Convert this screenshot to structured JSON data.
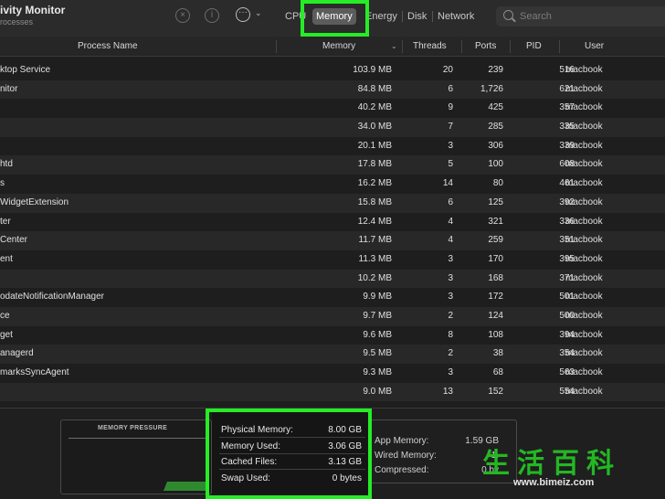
{
  "window": {
    "title": "ivity Monitor",
    "subtitle": "rocesses"
  },
  "toolbar": {
    "stop_icon": "x-circle-icon",
    "info_icon": "info-circle-icon",
    "more_icon": "ellipsis-circle-icon",
    "tabs": [
      {
        "label": "CPU",
        "active": false
      },
      {
        "label": "Memory",
        "active": true
      },
      {
        "label": "Energy",
        "active": false
      },
      {
        "label": "Disk",
        "active": false
      },
      {
        "label": "Network",
        "active": false
      }
    ],
    "search": {
      "placeholder": "Search",
      "value": ""
    }
  },
  "table": {
    "columns": [
      "Process Name",
      "Memory",
      "Threads",
      "Ports",
      "PID",
      "User"
    ],
    "sort_column": "Memory",
    "rows": [
      {
        "name": "ktop Service",
        "memory": "103.9 MB",
        "threads": "20",
        "ports": "239",
        "pid": "516",
        "user": "macbook"
      },
      {
        "name": "nitor",
        "memory": "84.8 MB",
        "threads": "6",
        "ports": "1,726",
        "pid": "621",
        "user": "macbook"
      },
      {
        "name": "",
        "memory": "40.2 MB",
        "threads": "9",
        "ports": "425",
        "pid": "357",
        "user": "macbook"
      },
      {
        "name": "",
        "memory": "34.0 MB",
        "threads": "7",
        "ports": "285",
        "pid": "335",
        "user": "macbook"
      },
      {
        "name": "",
        "memory": "20.1 MB",
        "threads": "3",
        "ports": "306",
        "pid": "339",
        "user": "macbook"
      },
      {
        "name": "htd",
        "memory": "17.8 MB",
        "threads": "5",
        "ports": "100",
        "pid": "608",
        "user": "macbook"
      },
      {
        "name": "s",
        "memory": "16.2 MB",
        "threads": "14",
        "ports": "80",
        "pid": "461",
        "user": "macbook"
      },
      {
        "name": "WidgetExtension",
        "memory": "15.8 MB",
        "threads": "6",
        "ports": "125",
        "pid": "392",
        "user": "macbook"
      },
      {
        "name": "ter",
        "memory": "12.4 MB",
        "threads": "4",
        "ports": "321",
        "pid": "336",
        "user": "macbook"
      },
      {
        "name": " Center",
        "memory": "11.7 MB",
        "threads": "4",
        "ports": "259",
        "pid": "351",
        "user": "macbook"
      },
      {
        "name": "ent",
        "memory": "11.3 MB",
        "threads": "3",
        "ports": "170",
        "pid": "395",
        "user": "macbook"
      },
      {
        "name": "",
        "memory": "10.2 MB",
        "threads": "3",
        "ports": "168",
        "pid": "371",
        "user": "macbook"
      },
      {
        "name": "odateNotificationManager",
        "memory": "9.9 MB",
        "threads": "3",
        "ports": "172",
        "pid": "501",
        "user": "macbook"
      },
      {
        "name": "ce",
        "memory": "9.7 MB",
        "threads": "2",
        "ports": "124",
        "pid": "500",
        "user": "macbook"
      },
      {
        "name": "get",
        "memory": "9.6 MB",
        "threads": "8",
        "ports": "108",
        "pid": "394",
        "user": "macbook"
      },
      {
        "name": "anagerd",
        "memory": "9.5 MB",
        "threads": "2",
        "ports": "38",
        "pid": "354",
        "user": "macbook"
      },
      {
        "name": "marksSyncAgent",
        "memory": "9.3 MB",
        "threads": "3",
        "ports": "68",
        "pid": "563",
        "user": "macbook"
      },
      {
        "name": "",
        "memory": "9.0 MB",
        "threads": "13",
        "ports": "152",
        "pid": "554",
        "user": "macbook"
      }
    ]
  },
  "memory_pressure": {
    "title": "MEMORY PRESSURE"
  },
  "stats": [
    {
      "label": "Physical Memory:",
      "value": "8.00 GB"
    },
    {
      "label": "Memory Used:",
      "value": "3.06 GB"
    },
    {
      "label": "Cached Files:",
      "value": "3.13 GB"
    },
    {
      "label": "Swap Used:",
      "value": "0 bytes"
    }
  ],
  "memory_breakdown": [
    {
      "label": "App Memory:",
      "value": "1.59 GB"
    },
    {
      "label": "Wired Memory:",
      "value": "1."
    },
    {
      "label": "Compressed:",
      "value": "0 by"
    }
  ],
  "watermark": {
    "chars": "生活百科",
    "url": "www.bimeiz.com"
  },
  "colors": {
    "highlight": "#26ec26",
    "active_tab": "#5c5c5c",
    "window_bg": "#1e1e1e"
  }
}
